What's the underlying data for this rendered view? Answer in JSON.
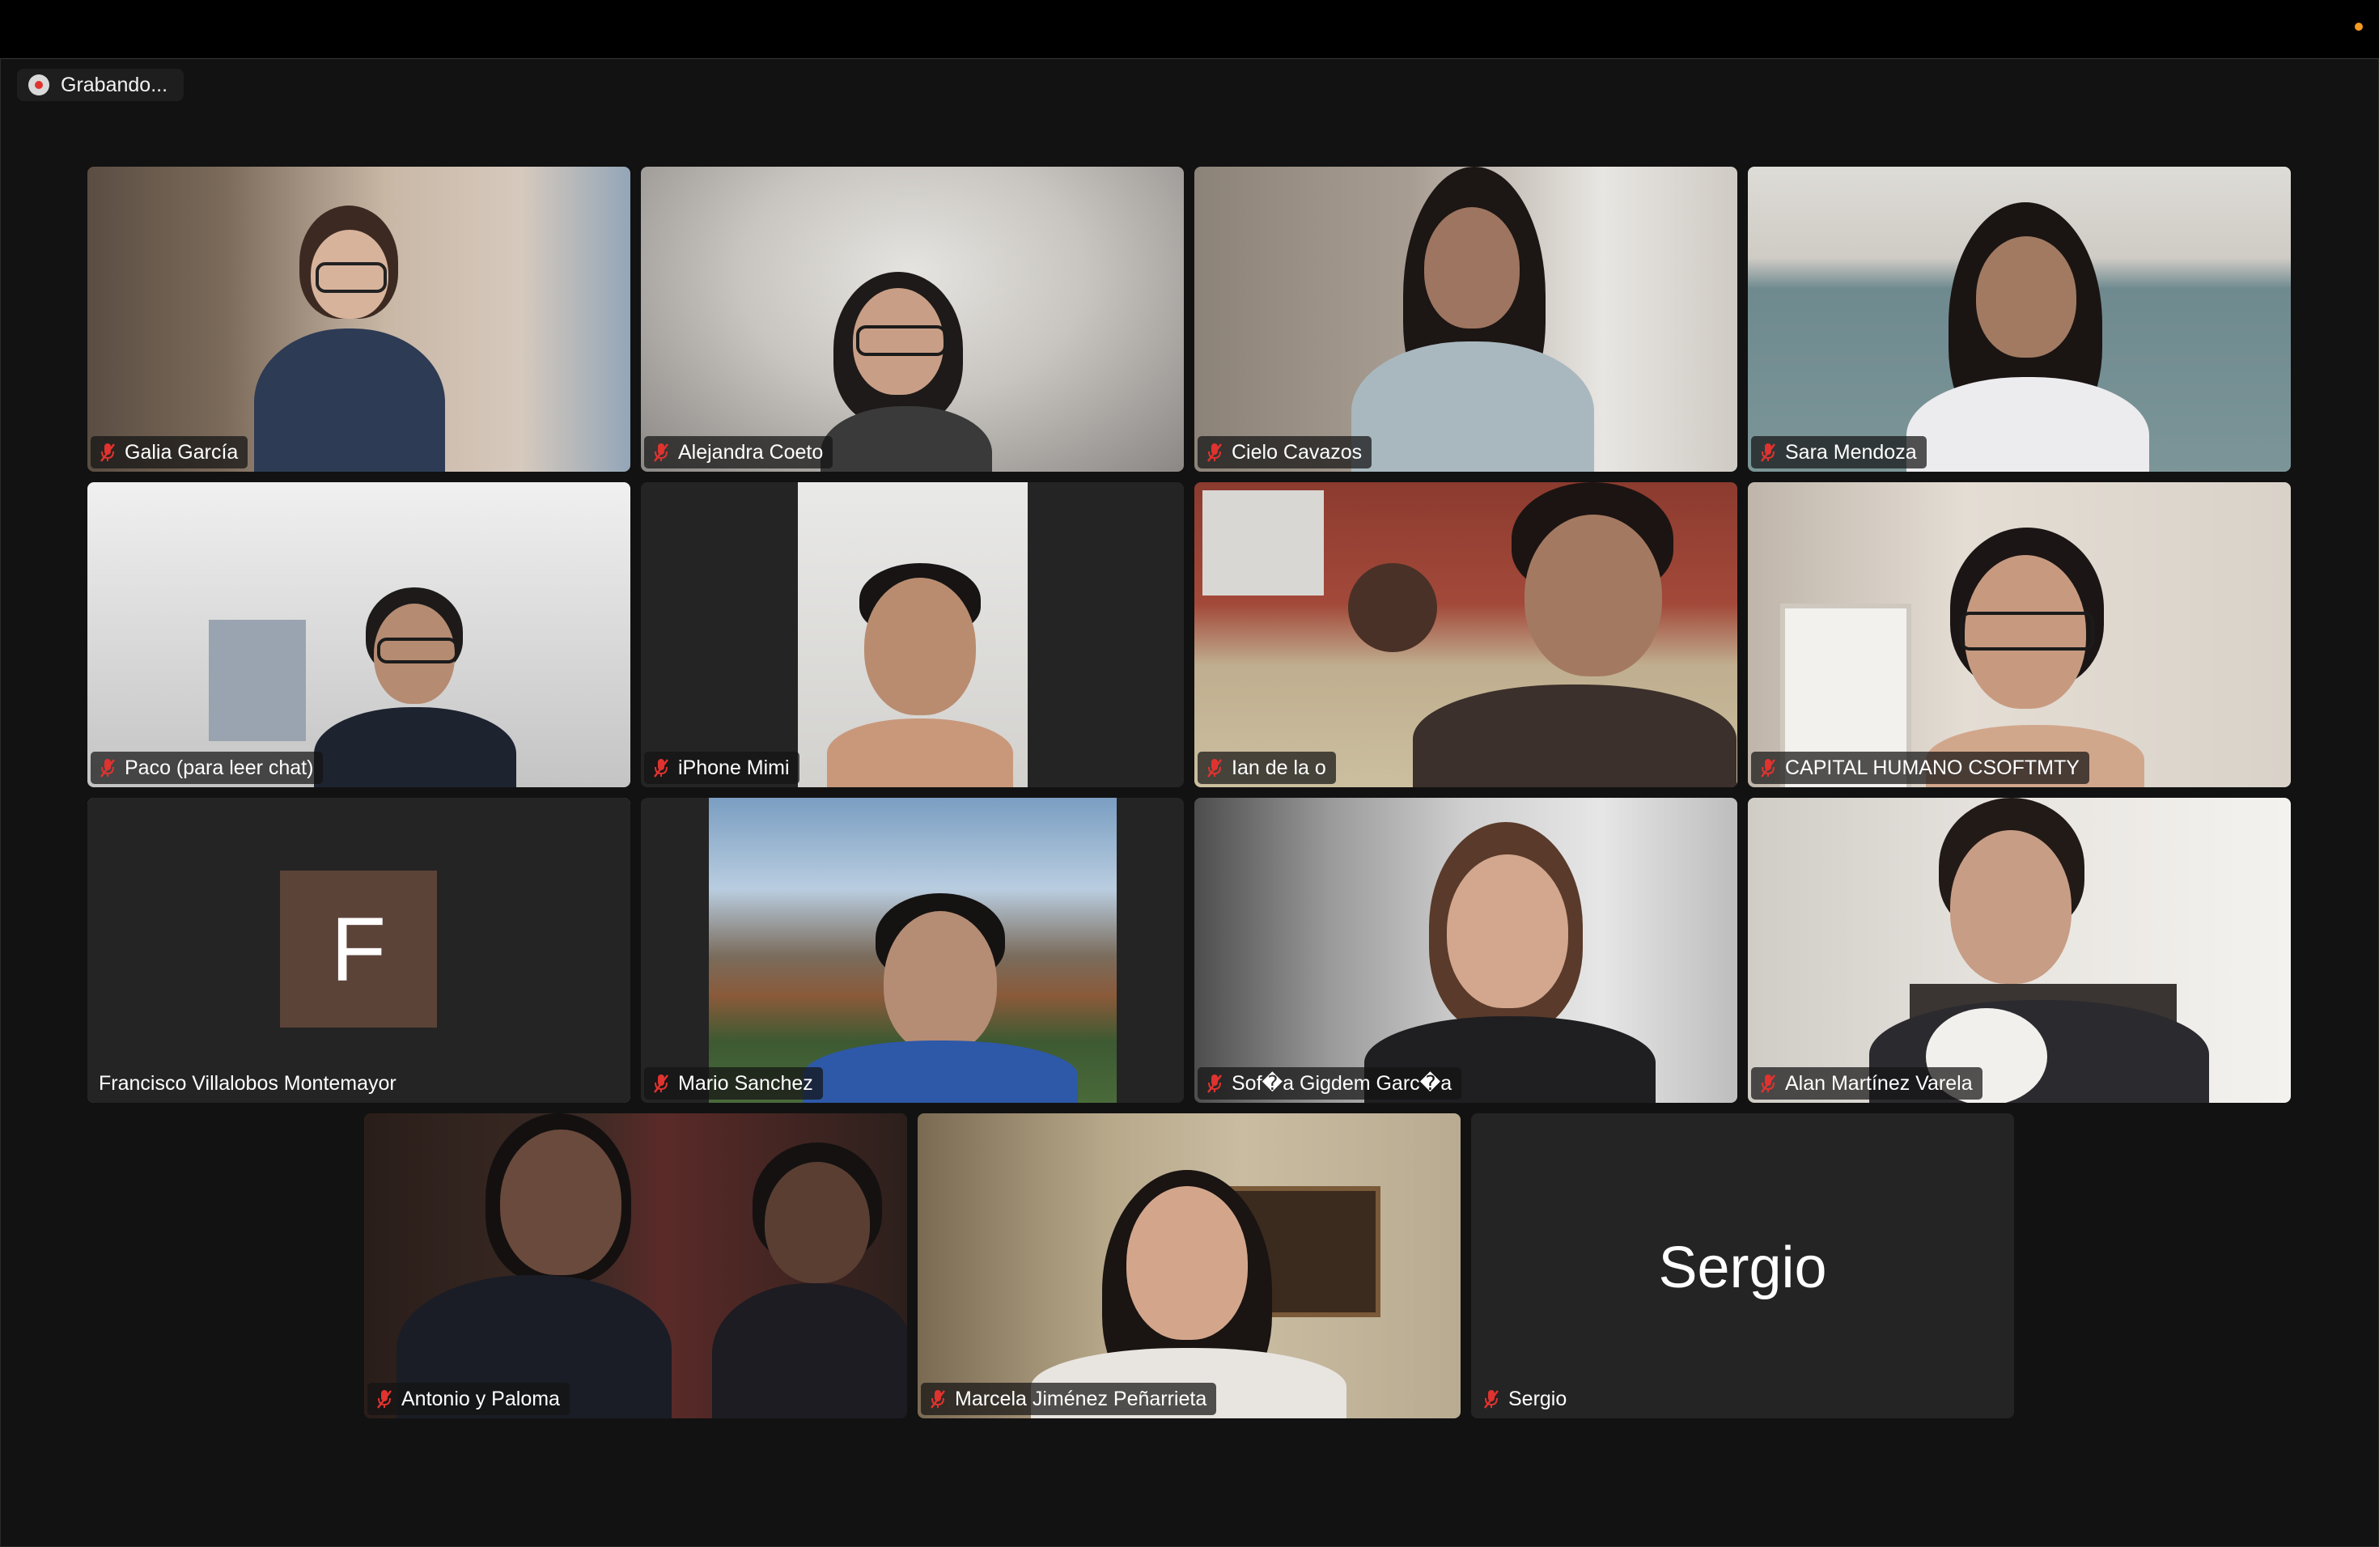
{
  "window": {
    "recording_label": "Grabando..."
  },
  "participants": [
    {
      "name": "Galia García"
    },
    {
      "name": "Alejandra Coeto"
    },
    {
      "name": "Cielo Cavazos"
    },
    {
      "name": "Sara Mendoza"
    },
    {
      "name": "Paco (para leer chat)"
    },
    {
      "name": "iPhone Mimi"
    },
    {
      "name": "Ian de la o"
    },
    {
      "name": "CAPITAL HUMANO CSOFTMTY"
    },
    {
      "name": "Francisco Villalobos Montemayor",
      "avatar_letter": "F",
      "avatar_color": "#5c4338",
      "active_speaker_color": "#4fd36a"
    },
    {
      "name": "Mario Sanchez"
    },
    {
      "name": "Sof�a Gigdem Garc�a"
    },
    {
      "name": "Alan Martínez Varela"
    },
    {
      "name": "Antonio y Paloma"
    },
    {
      "name": "Marcela Jiménez Peñarrieta"
    },
    {
      "name": "Sergio",
      "display_text": "Sergio"
    }
  ],
  "icons": {
    "muted": "mic-muted-icon",
    "recording": "record-icon"
  },
  "colors": {
    "titlebar_dot": "#f59b22",
    "recording_dot": "#e0332f",
    "muted_icon": "#e0332f"
  }
}
